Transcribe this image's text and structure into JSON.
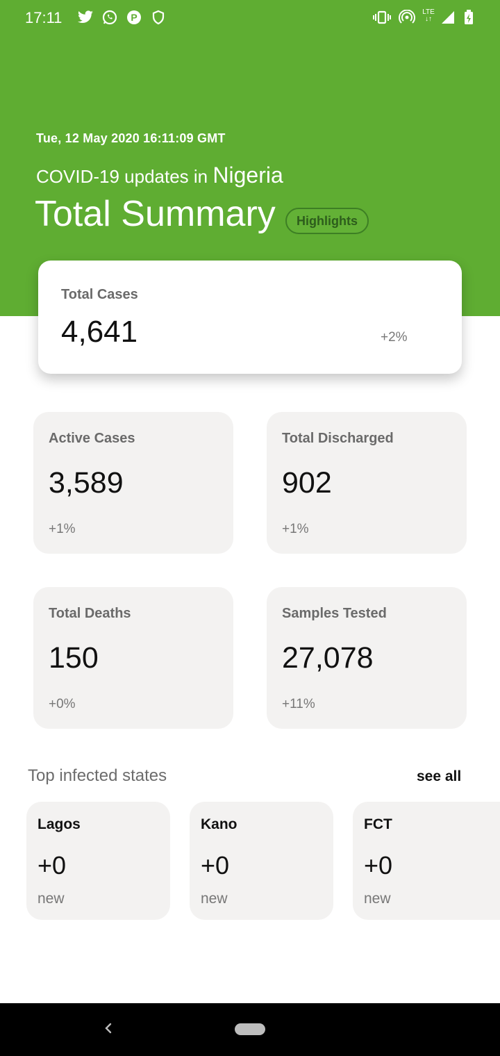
{
  "status_bar": {
    "time": "17:11",
    "icons_left": [
      "twitter-icon",
      "whatsapp-icon",
      "p-app-icon",
      "shield-icon"
    ],
    "icons_right": [
      "vibrate-icon",
      "hotspot-icon",
      "lte-icon",
      "signal-icon",
      "battery-icon"
    ],
    "lte_label": "LTE"
  },
  "header": {
    "background_color": "#5fad32",
    "date": "Tue, 12 May 2020 16:11:09 GMT",
    "subtitle_prefix": "COVID-19 updates in",
    "country": "Nigeria",
    "title": "Total Summary",
    "highlights_label": "Highlights"
  },
  "total_cases": {
    "label": "Total Cases",
    "value": "4,641",
    "delta": "+2%"
  },
  "stats": [
    {
      "label": "Active Cases",
      "value": "3,589",
      "delta": "+1%"
    },
    {
      "label": "Total Discharged",
      "value": "902",
      "delta": "+1%"
    },
    {
      "label": "Total Deaths",
      "value": "150",
      "delta": "+0%"
    },
    {
      "label": "Samples Tested",
      "value": "27,078",
      "delta": "+11%"
    }
  ],
  "top_states": {
    "title": "Top infected states",
    "see_all_label": "see all",
    "items": [
      {
        "name": "Lagos",
        "count": "+0",
        "note": "new"
      },
      {
        "name": "Kano",
        "count": "+0",
        "note": "new"
      },
      {
        "name": "FCT",
        "count": "+0",
        "note": "new"
      }
    ]
  },
  "nav_bar": {
    "icons": [
      "back-icon",
      "home-pill-icon"
    ]
  }
}
